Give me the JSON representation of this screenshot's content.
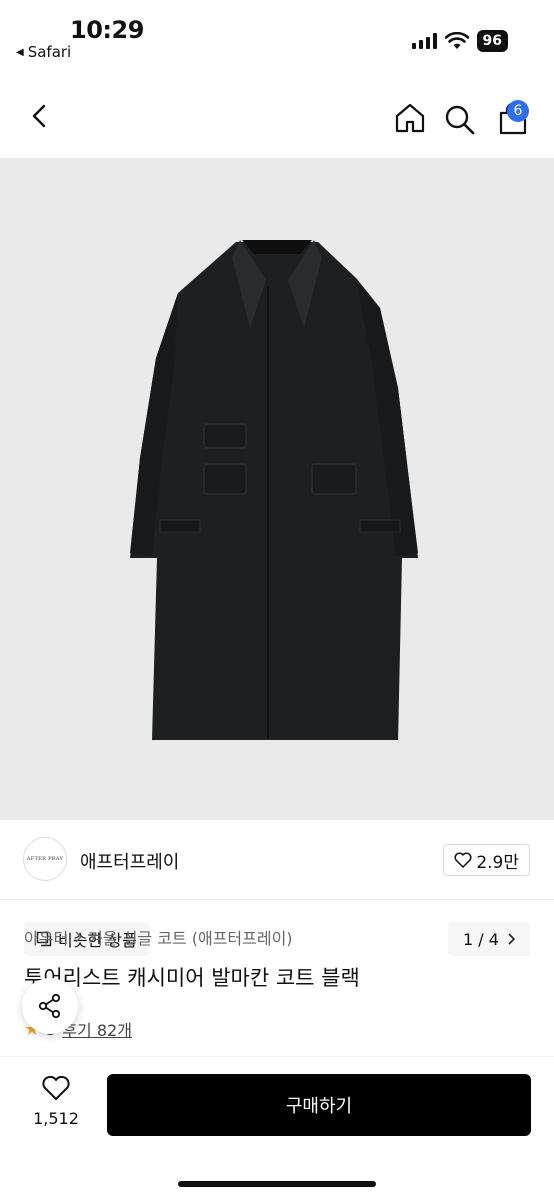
{
  "status_bar": {
    "time": "10:29",
    "back_app": "Safari",
    "battery": "96"
  },
  "nav": {
    "cart_count": "6"
  },
  "gallery": {
    "similar_label": "비슷한 상품",
    "pager": "1 / 4"
  },
  "brand": {
    "logo_text": "AFTER PRAY",
    "name": "애프터프레이",
    "likes": "2.9만"
  },
  "product": {
    "breadcrumb": [
      "아우터",
      "겨울 싱글 코트 (애프터프레이)"
    ],
    "title": "투어리스트 캐시미어 발마칸 코트 블랙",
    "rating": "5",
    "reviews": "후기 82개"
  },
  "bottom": {
    "wish_count": "1,512",
    "buy_label": "구매하기"
  }
}
